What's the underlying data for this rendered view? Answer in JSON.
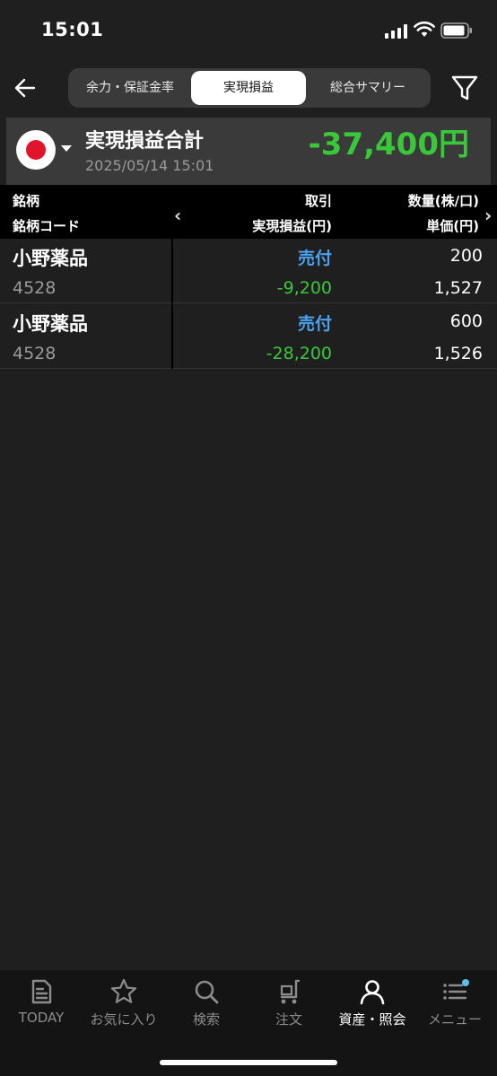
{
  "status": {
    "time": "15:01"
  },
  "header": {
    "tabs": [
      {
        "label": "余力・保証金率",
        "active": false
      },
      {
        "label": "実現損益",
        "active": true
      },
      {
        "label": "総合サマリー",
        "active": false
      }
    ]
  },
  "summary": {
    "title": "実現損益合計",
    "datetime": "2025/05/14 15:01",
    "total": "-37,400円",
    "market_flag": "japan-flag-icon"
  },
  "table": {
    "headers": {
      "name": "銘柄",
      "code": "銘柄コード",
      "trade": "取引",
      "pnl": "実現損益(円)",
      "qty": "数量(株/口)",
      "price": "単価(円)"
    },
    "rows": [
      {
        "name": "小野薬品",
        "code": "4528",
        "trade": "売付",
        "pnl": "-9,200",
        "qty": "200",
        "price": "1,527"
      },
      {
        "name": "小野薬品",
        "code": "4528",
        "trade": "売付",
        "pnl": "-28,200",
        "qty": "600",
        "price": "1,526"
      }
    ]
  },
  "bottom_nav": {
    "items": [
      {
        "label": "TODAY",
        "icon": "news-icon",
        "active": false
      },
      {
        "label": "お気に入り",
        "icon": "star-icon",
        "active": false
      },
      {
        "label": "検索",
        "icon": "search-icon",
        "active": false
      },
      {
        "label": "注文",
        "icon": "cart-icon",
        "active": false
      },
      {
        "label": "資産・照会",
        "icon": "person-icon",
        "active": true
      },
      {
        "label": "メニュー",
        "icon": "menu-list-icon",
        "active": false
      }
    ]
  },
  "colors": {
    "positive_green": "#39c83a",
    "trade_blue": "#4aa3f0",
    "background": "#1f1f1f",
    "panel": "#3a3a3a"
  }
}
